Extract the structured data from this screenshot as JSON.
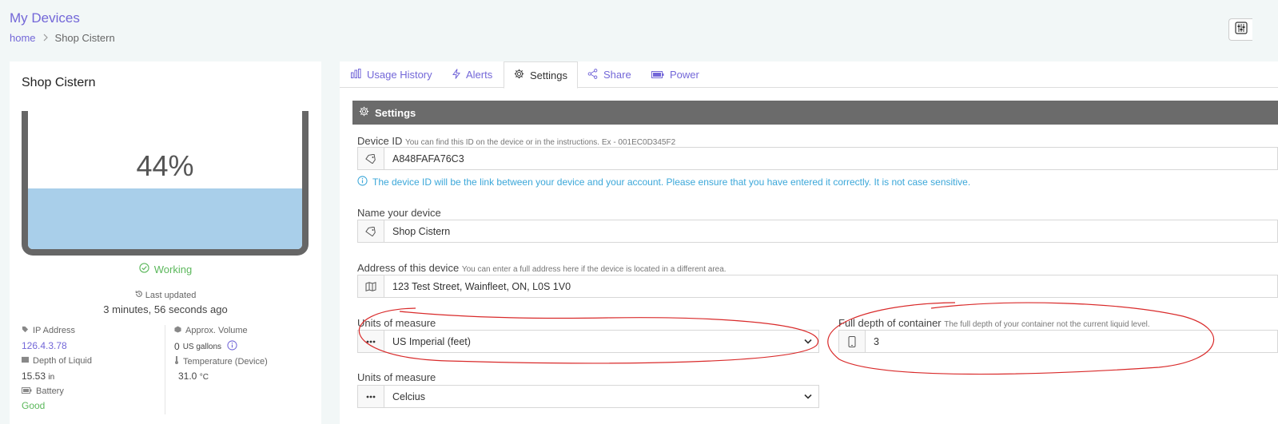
{
  "header": {
    "title": "My Devices",
    "breadcrumb_home": "home",
    "breadcrumb_current": "Shop Cistern"
  },
  "device_card": {
    "name": "Shop Cistern",
    "level_percent": "44%",
    "level_fraction": 0.44,
    "status": "Working",
    "last_updated_label": "Last updated",
    "last_updated_value": "3 minutes, 56 seconds ago",
    "stats": {
      "ip_label": "IP Address",
      "ip_value": "126.4.3.78",
      "volume_label": "Approx. Volume",
      "volume_value": "0",
      "volume_unit": "US gallons",
      "depth_label": "Depth of Liquid",
      "depth_value": "15.53",
      "depth_unit": "in",
      "temp_label": "Temperature (Device)",
      "temp_value": "31.0",
      "temp_unit": "°C",
      "battery_label": "Battery",
      "battery_value": "Good"
    }
  },
  "tabs": [
    {
      "label": "Usage History",
      "icon": "bar-chart-icon"
    },
    {
      "label": "Alerts",
      "icon": "bolt-icon"
    },
    {
      "label": "Settings",
      "icon": "gear-icon"
    },
    {
      "label": "Share",
      "icon": "share-icon"
    },
    {
      "label": "Power",
      "icon": "battery-icon"
    }
  ],
  "active_tab": "Settings",
  "settings": {
    "header": "Settings",
    "device_id_label": "Device ID",
    "device_id_hint": "You can find this ID on the device or in the instructions. Ex - 001EC0D345F2",
    "device_id_value": "A848FAFA76C3",
    "device_id_info": "The device ID will be the link between your device and your account. Please ensure that you have entered it correctly. It is not case sensitive.",
    "name_label": "Name your device",
    "name_value": "Shop Cistern",
    "address_label": "Address of this device",
    "address_hint": "You can enter a full address here if the device is located in a different area.",
    "address_value": "123 Test Street, Wainfleet, ON, L0S 1V0",
    "units_label": "Units of measure",
    "units_value": "US Imperial (feet)",
    "depth_label": "Full depth of container",
    "depth_hint": "The full depth of your container not the current liquid level.",
    "depth_value": "3",
    "temp_units_label": "Units of measure",
    "temp_units_value": "Celcius"
  },
  "colors": {
    "accent": "#7367d8",
    "tank_fill": "#a9cfea",
    "status_green": "#5cb85c",
    "info_blue": "#3ba7d9",
    "annotation_red": "#d92a2a"
  }
}
